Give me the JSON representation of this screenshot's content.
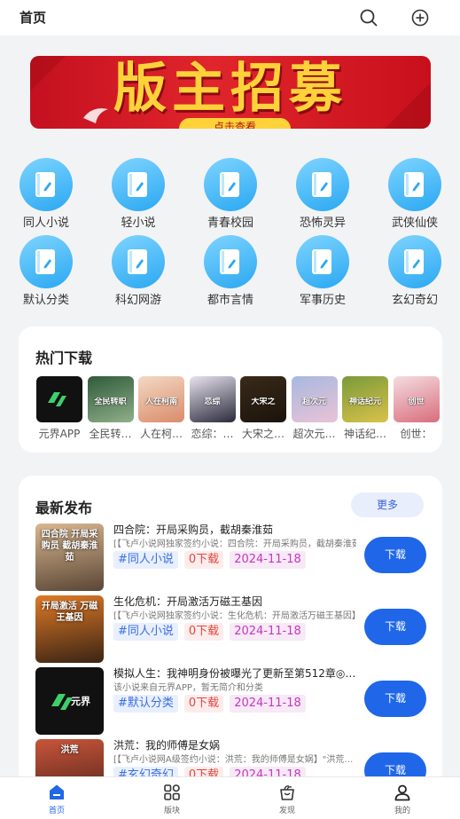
{
  "header": {
    "title": "首页",
    "search_icon": "search-icon",
    "add_icon": "add-circle-icon"
  },
  "banner": {
    "headline": "版主招募",
    "button_label": "点击查看"
  },
  "categories": [
    {
      "label": "同人小说",
      "icon": "book-icon"
    },
    {
      "label": "轻小说",
      "icon": "book-icon"
    },
    {
      "label": "青春校园",
      "icon": "book-icon"
    },
    {
      "label": "恐怖灵异",
      "icon": "book-icon"
    },
    {
      "label": "武侠仙侠",
      "icon": "book-icon"
    },
    {
      "label": "默认分类",
      "icon": "book-icon"
    },
    {
      "label": "科幻网游",
      "icon": "book-icon"
    },
    {
      "label": "都市言情",
      "icon": "book-icon"
    },
    {
      "label": "军事历史",
      "icon": "book-icon"
    },
    {
      "label": "玄幻奇幻",
      "icon": "book-icon"
    }
  ],
  "hot": {
    "title": "热门下载",
    "items": [
      {
        "name": "元界APP",
        "cover_text": "元界",
        "color_a": "#111111",
        "color_b": "#1d1d1d"
      },
      {
        "name": "全民转…",
        "cover_text": "全民转职",
        "color_a": "#2f5a3a",
        "color_b": "#8fb08a"
      },
      {
        "name": "人在柯…",
        "cover_text": "人在柯南",
        "color_a": "#f3d9c4",
        "color_b": "#d98b6a"
      },
      {
        "name": "恋综：…",
        "cover_text": "恋综",
        "color_a": "#e8e3ef",
        "color_b": "#2a2a3a"
      },
      {
        "name": "大宋之…",
        "cover_text": "大宋之",
        "color_a": "#3a2a18",
        "color_b": "#1a130c"
      },
      {
        "name": "超次元…",
        "cover_text": "超次元",
        "color_a": "#a8b8e0",
        "color_b": "#e9c3d6"
      },
      {
        "name": "神话纪…",
        "cover_text": "神话纪元",
        "color_a": "#7a9a3a",
        "color_b": "#d9c24a"
      },
      {
        "name": "创世：",
        "cover_text": "创世",
        "color_a": "#f4dde0",
        "color_b": "#d96c7c"
      }
    ]
  },
  "latest": {
    "title": "最新发布",
    "more_label": "更多",
    "rows": [
      {
        "title": "四合院：开局采购员，截胡秦淮茹",
        "desc": "[【飞卢小说网独家签约小说：四合院：开局采购员，截胡秦淮茹】",
        "category": "#同人小说",
        "downloads": "0下载",
        "date": "2024-11-18",
        "button": "下载",
        "cover_text": "四合院 开局采购员 截胡秦淮茹",
        "color_a": "#d9b78f",
        "color_b": "#5a4636"
      },
      {
        "title": "生化危机：开局激活万磁王基因",
        "desc": "[【飞卢小说网独家签约小说：生化危机：开局激活万磁王基因】",
        "category": "#同人小说",
        "downloads": "0下载",
        "date": "2024-11-18",
        "button": "下载",
        "cover_text": "开局激活 万磁王基因",
        "color_a": "#e07a26",
        "color_b": "#3a2414"
      },
      {
        "title": "模拟人生：我神明身份被曝光了更新至第512章◎…",
        "desc": "该小说来自元界APP，暂无简介和分类",
        "category": "#默认分类",
        "downloads": "0下载",
        "date": "2024-11-18",
        "button": "下载",
        "cover_text": "元界",
        "color_a": "#111111",
        "color_b": "#1a1a1a"
      },
      {
        "title": "洪荒：我的师傅是女娲",
        "desc": "[【飞卢小说网A级签约小说：洪荒：我的师傅是女娲】\"洪荒…",
        "category": "#玄幻奇幻",
        "downloads": "0下载",
        "date": "2024-11-18",
        "button": "下载",
        "cover_text": "洪荒",
        "color_a": "#c8553a",
        "color_b": "#4a2018"
      }
    ]
  },
  "tabbar": [
    {
      "label": "首页",
      "icon": "home-icon",
      "active": true
    },
    {
      "label": "版块",
      "icon": "grid-icon",
      "active": false
    },
    {
      "label": "发现",
      "icon": "discover-icon",
      "active": false
    },
    {
      "label": "我的",
      "icon": "user-icon",
      "active": false
    }
  ],
  "colors": {
    "accent": "#1f67e8",
    "category_circle": "#2aa8f2"
  }
}
